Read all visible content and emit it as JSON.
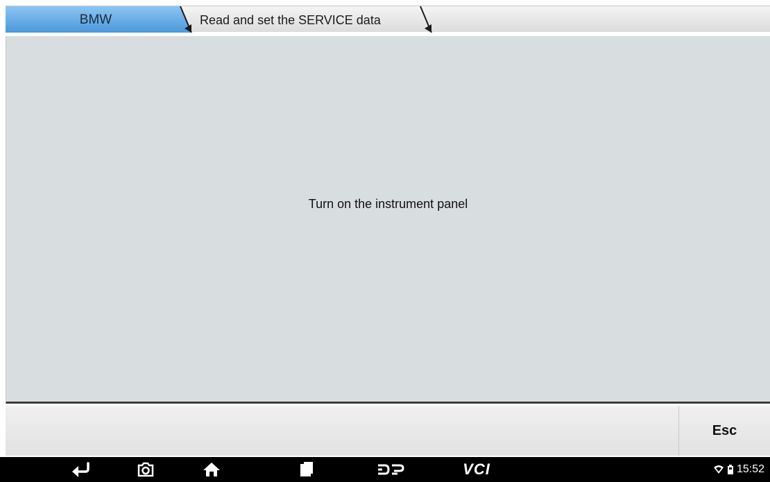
{
  "breadcrumb": {
    "items": [
      {
        "label": "BMW"
      },
      {
        "label": "Read and set the SERVICE data"
      }
    ]
  },
  "main": {
    "message": "Turn on the instrument panel"
  },
  "buttons": {
    "esc_label": "Esc"
  },
  "navbar": {
    "icons": [
      "back-icon",
      "screenshot-icon",
      "home-icon",
      "recent-apps-icon",
      "dp-icon"
    ],
    "vci_label": "VCI"
  },
  "status": {
    "time": "15:52",
    "icons": [
      "wifi-icon",
      "battery-icon"
    ]
  },
  "colors": {
    "active_tab": "#5aa7e6",
    "content_bg": "#d8dde0",
    "nav_bar": "#000000"
  }
}
